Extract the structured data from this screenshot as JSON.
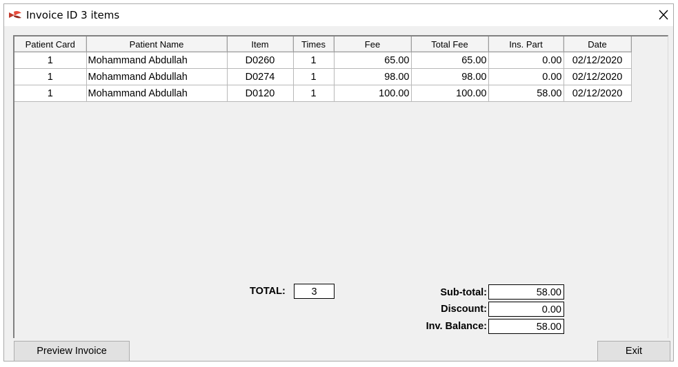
{
  "window": {
    "title": "Invoice ID 3 items"
  },
  "table": {
    "columns": [
      "Patient Card",
      "Patient Name",
      "Item",
      "Times",
      "Fee",
      "Total Fee",
      "Ins. Part",
      "Date"
    ],
    "rows": [
      [
        "1",
        "Mohammand Abdullah",
        "D0260",
        "1",
        "65.00",
        "65.00",
        "0.00",
        "02/12/2020"
      ],
      [
        "1",
        "Mohammand Abdullah",
        "D0274",
        "1",
        "98.00",
        "98.00",
        "0.00",
        "02/12/2020"
      ],
      [
        "1",
        "Mohammand Abdullah",
        "D0120",
        "1",
        "100.00",
        "100.00",
        "58.00",
        "02/12/2020"
      ]
    ]
  },
  "totals": {
    "total_label": "TOTAL:",
    "total_value": "3",
    "subtotal_label": "Sub-total:",
    "subtotal_value": "58.00",
    "discount_label": "Discount:",
    "discount_value": "0.00",
    "balance_label": "Inv. Balance:",
    "balance_value": "58.00"
  },
  "buttons": {
    "preview": "Preview Invoice",
    "exit": "Exit"
  },
  "icons": {
    "app": "app-logo-icon",
    "close": "close-icon"
  }
}
